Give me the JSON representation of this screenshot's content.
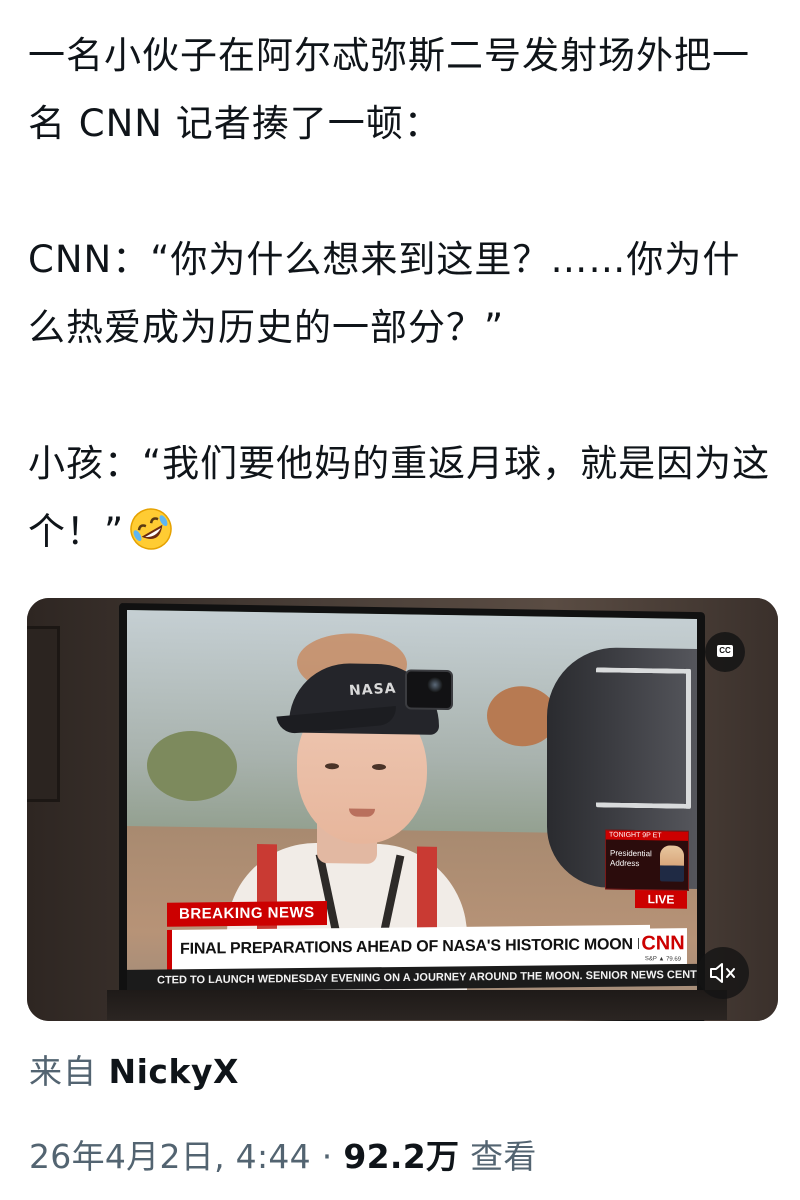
{
  "post": {
    "paragraphs": [
      "一名小伙子在阿尔忒弥斯二号发射场外把一名 CNN 记者揍了一顿：",
      "CNN：“你为什么想来到这里？……你为什么热爱成为历史的一部分？”",
      "小孩：“我们要他妈的重返月球，就是因为这个！”"
    ],
    "emoji": "rolling-on-floor-laughing-emoji"
  },
  "video": {
    "cc_label": "CC",
    "mute_icon": "speaker-muted-icon",
    "tv": {
      "cap_logo": "NASA",
      "breaking_label": "BREAKING NEWS",
      "headline": "FINAL PREPARATIONS AHEAD OF NASA'S HISTORIC MOON MISSION",
      "ticker": "CTED TO LAUNCH WEDNESDAY EVENING ON A JOURNEY AROUND THE MOON. SENIOR NEWS CENTRAL",
      "network_logo": "CNN",
      "market_sub": "S&P ▲ 79.69",
      "live_label": "LIVE",
      "promo_top": "TONIGHT 9P ET",
      "promo_text": "Presidential Address"
    }
  },
  "source": {
    "prefix": "来自",
    "author": "NickyX"
  },
  "meta": {
    "date": "26年4月2日, 4:44",
    "separator": "·",
    "views": "92.2万",
    "views_label": "查看"
  },
  "colors": {
    "text_primary": "#0f1419",
    "text_secondary": "#536471",
    "cnn_red": "#cc0000"
  }
}
